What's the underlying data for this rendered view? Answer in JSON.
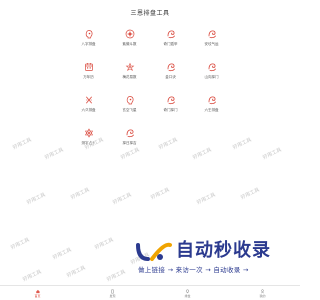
{
  "header": {
    "title": "三恩排盘工具"
  },
  "colors": {
    "accent": "#d9463a",
    "brand_blue": "#2b3a8f"
  },
  "tools": [
    {
      "label": "八字排盘",
      "icon": "person-head-icon"
    },
    {
      "label": "紫微斗数",
      "icon": "star-compass-icon"
    },
    {
      "label": "奇门遁甲",
      "icon": "dragon-icon"
    },
    {
      "label": "安坟气运",
      "icon": "dragon-icon"
    },
    {
      "label": "万年历",
      "icon": "calendar-icon"
    },
    {
      "label": "梅花易数",
      "icon": "flower-icon"
    },
    {
      "label": "金口诀",
      "icon": "dragon-icon"
    },
    {
      "label": "山向择门",
      "icon": "dragon-icon"
    },
    {
      "label": "六爻排盘",
      "icon": "yao-lines-icon"
    },
    {
      "label": "玄空飞星",
      "icon": "person-head-icon"
    },
    {
      "label": "奇门择门",
      "icon": "dragon-icon"
    },
    {
      "label": "六壬排盘",
      "icon": "dragon-icon"
    },
    {
      "label": "测字占卜",
      "icon": "hexagram-icon"
    },
    {
      "label": "择日择吉",
      "icon": "dragon-icon"
    }
  ],
  "watermark_text": "好用工具",
  "banner": {
    "title": "自动秒收录",
    "subtitle": "做上链接 → 来访一次 → 自动收录 →"
  },
  "tabs": [
    {
      "label": "首页",
      "icon": "home-icon",
      "active": true
    },
    {
      "label": "发现",
      "icon": "compass-icon",
      "active": false
    },
    {
      "label": "排盘",
      "icon": "grid-icon",
      "active": false
    },
    {
      "label": "我的",
      "icon": "user-icon",
      "active": false
    }
  ]
}
